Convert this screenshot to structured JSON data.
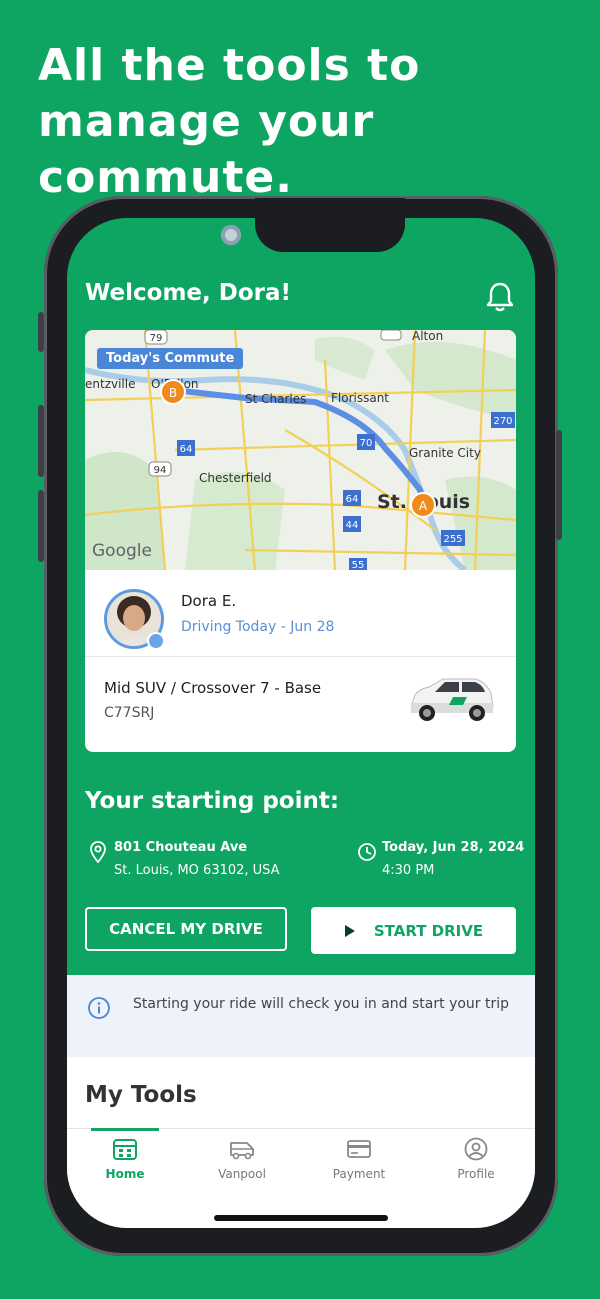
{
  "headline": "All the tools to manage your commute.",
  "header": {
    "welcome": "Welcome, Dora!"
  },
  "map": {
    "badge": "Today's Commute",
    "labels": {
      "wentzville": "entzville",
      "ofallon": "O'Fallon",
      "stcharles": "St Charles",
      "florissant": "Florissant",
      "alton": "Alton",
      "granite": "Granite City",
      "chesterfield": "Chesterfield",
      "stlouis": "St. Louis",
      "google": "Google",
      "hw79": "79",
      "hw94": "94",
      "hw64": "64",
      "hw70": "70",
      "hw270": "270",
      "hw44": "44",
      "hw255": "255",
      "hw55": "55",
      "hw64b": "64"
    },
    "marker_a": "A",
    "marker_b": "B"
  },
  "driver": {
    "name": "Dora E.",
    "status": "Driving Today - Jun 28"
  },
  "vehicle": {
    "name": "Mid SUV / Crossover 7 - Base",
    "plate": "C77SRJ"
  },
  "start": {
    "title": "Your starting point:",
    "address_line1": "801 Chouteau Ave",
    "address_line2": "St. Louis, MO 63102, USA",
    "date": "Today, Jun 28, 2024",
    "time": "4:30 PM"
  },
  "buttons": {
    "cancel": "CANCEL MY DRIVE",
    "start": "START DRIVE"
  },
  "info": {
    "text": "Starting your ride will check you in and start your trip"
  },
  "tools": {
    "title": "My Tools"
  },
  "tabs": [
    {
      "label": "Home",
      "icon": "home-calendar-icon",
      "active": true
    },
    {
      "label": "Vanpool",
      "icon": "van-icon",
      "active": false
    },
    {
      "label": "Payment",
      "icon": "credit-card-icon",
      "active": false
    },
    {
      "label": "Profile",
      "icon": "profile-icon",
      "active": false
    }
  ],
  "colors": {
    "brand": "#0ea562",
    "route": "#5b8fe3",
    "marker": "#f08a1c",
    "info_bg": "#eef2fb"
  }
}
